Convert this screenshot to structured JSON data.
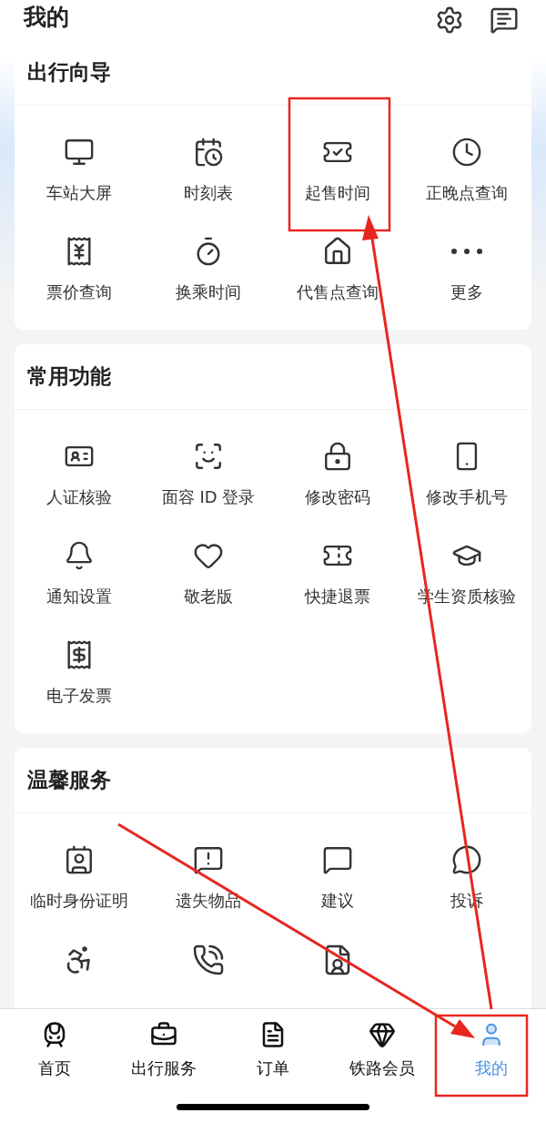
{
  "header": {
    "title": "我的"
  },
  "sections": [
    {
      "title": "出行向导",
      "items": [
        {
          "kind": "item",
          "label": "车站大屏"
        },
        {
          "kind": "item",
          "label": "时刻表"
        },
        {
          "kind": "item",
          "label": "起售时间"
        },
        {
          "kind": "item",
          "label": "正晚点查询"
        },
        {
          "kind": "item",
          "label": "票价查询"
        },
        {
          "kind": "item",
          "label": "换乘时间"
        },
        {
          "kind": "item",
          "label": "代售点查询"
        },
        {
          "kind": "item",
          "label": "更多"
        }
      ]
    },
    {
      "title": "常用功能",
      "items": [
        {
          "kind": "item",
          "label": "人证核验"
        },
        {
          "kind": "item",
          "label": "面容 ID 登录"
        },
        {
          "kind": "item",
          "label": "修改密码"
        },
        {
          "kind": "item",
          "label": "修改手机号"
        },
        {
          "kind": "item",
          "label": "通知设置"
        },
        {
          "kind": "item",
          "label": "敬老版"
        },
        {
          "kind": "item",
          "label": "快捷退票"
        },
        {
          "kind": "item",
          "label": "学生资质核验"
        },
        {
          "kind": "item",
          "label": "电子发票"
        }
      ]
    },
    {
      "title": "温馨服务",
      "items": [
        {
          "kind": "item",
          "label": "临时身份证明"
        },
        {
          "kind": "item",
          "label": "遗失物品"
        },
        {
          "kind": "item",
          "label": "建议"
        },
        {
          "kind": "item",
          "label": "投诉"
        },
        {
          "kind": "icon_only"
        },
        {
          "kind": "icon_only"
        },
        {
          "kind": "icon_only"
        }
      ]
    }
  ],
  "tabs": [
    {
      "label": "首页",
      "selected": false
    },
    {
      "label": "出行服务",
      "selected": false
    },
    {
      "label": "订单",
      "selected": false
    },
    {
      "label": "铁路会员",
      "selected": false
    },
    {
      "label": "我的",
      "selected": true
    }
  ]
}
